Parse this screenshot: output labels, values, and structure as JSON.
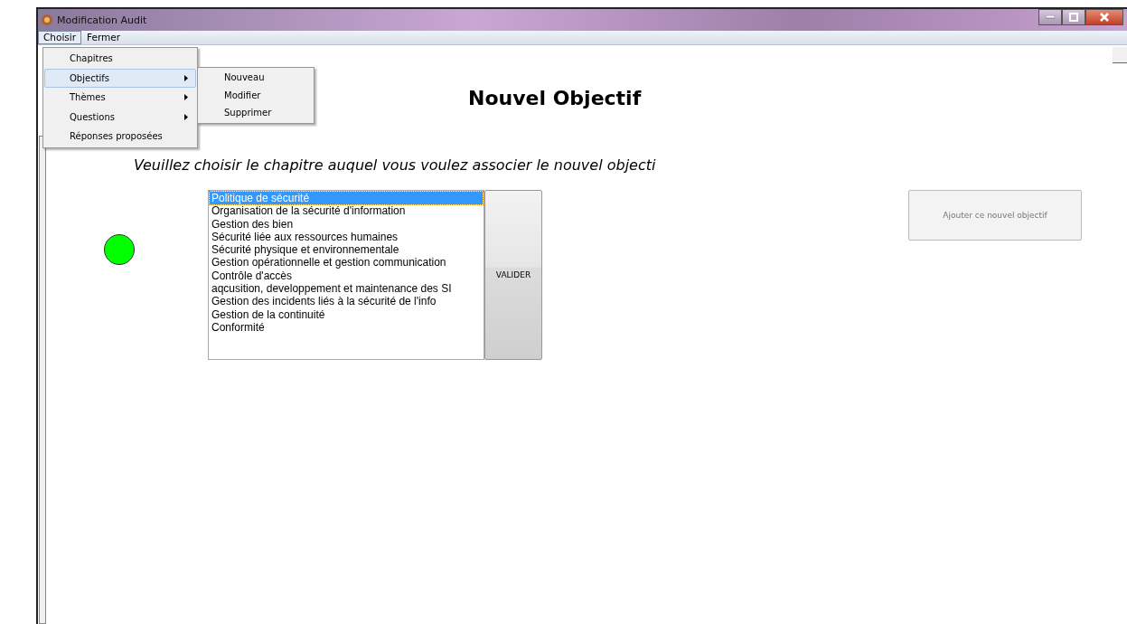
{
  "window": {
    "title": "Modification Audit"
  },
  "menu_bar": [
    {
      "label": "Choisir",
      "selected": true
    },
    {
      "label": "Fermer",
      "selected": false
    }
  ],
  "menu": {
    "items": [
      {
        "label": "Chapitres",
        "submenu": false,
        "selected": false
      },
      {
        "label": "Objectifs",
        "submenu": true,
        "selected": true
      },
      {
        "label": "Thèmes",
        "submenu": true,
        "selected": false
      },
      {
        "label": "Questions",
        "submenu": true,
        "selected": false
      },
      {
        "label": "Réponses proposées",
        "submenu": false,
        "selected": false
      }
    ],
    "submenu": [
      "Nouveau",
      "Modifier",
      "Supprimer"
    ]
  },
  "heading": "Nouvel Objectif",
  "prompt": "Veuillez choisir le chapitre auquel vous voulez associer le nouvel objecti",
  "status": {
    "color": "#00ff00"
  },
  "chapters": [
    {
      "label": "Politique de sécurité",
      "selected": true
    },
    {
      "label": "Organisation de la sécurité d'information",
      "selected": false
    },
    {
      "label": "Gestion des bien",
      "selected": false
    },
    {
      "label": "Sécurité liée aux ressources humaines",
      "selected": false
    },
    {
      "label": "Sécurité physique et environnementale",
      "selected": false
    },
    {
      "label": "Gestion opérationnelle et gestion communication",
      "selected": false
    },
    {
      "label": "Contrôle d'accès",
      "selected": false
    },
    {
      "label": "aqcusition, developpement et maintenance des SI",
      "selected": false
    },
    {
      "label": "Gestion des incidents liés à la sécurité de l'info",
      "selected": false
    },
    {
      "label": "Gestion de la continuité",
      "selected": false
    },
    {
      "label": "Conformité",
      "selected": false
    }
  ],
  "validate_button": "VALIDER",
  "add_button": {
    "label": "Ajouter ce nouvel objectif",
    "disabled": true
  }
}
